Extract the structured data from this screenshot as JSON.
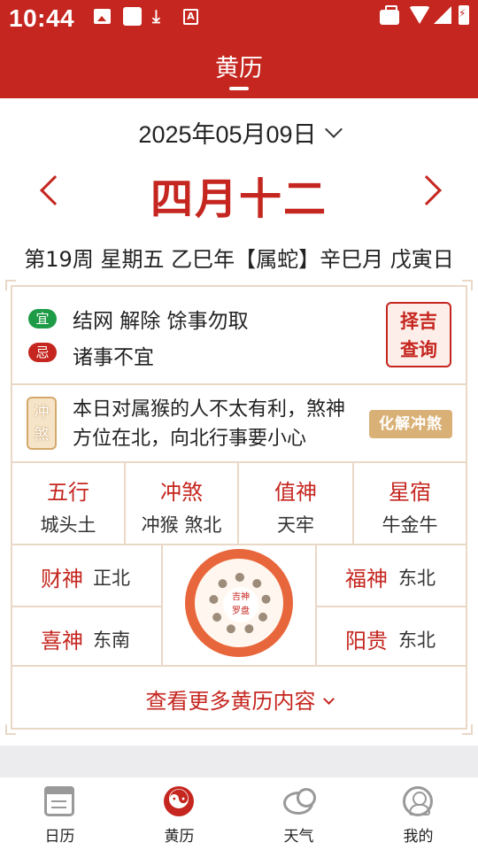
{
  "status_bar": {
    "time": "10:44",
    "a_icon": "A"
  },
  "header": {
    "title": "黄历"
  },
  "date": {
    "solar": "2025年05月09日",
    "lunar": "四月十二",
    "detail": "第19周 星期五 乙巳年【属蛇】辛巳月 戊寅日"
  },
  "yi_ji": {
    "yi_tag": "宜",
    "yi_text": "结网 解除 馀事勿取",
    "ji_tag": "忌",
    "ji_text": "诸事不宜",
    "zeji_line1": "择吉",
    "zeji_line2": "查询"
  },
  "chongsha": {
    "badge_line1": "冲",
    "badge_line2": "煞",
    "text": "本日对属猴的人不太有利，煞神方位在北，向北行事要小心",
    "button": "化解冲煞"
  },
  "attributes": [
    {
      "label": "五行",
      "value": "城头土"
    },
    {
      "label": "冲煞",
      "value": "冲猴 煞北"
    },
    {
      "label": "值神",
      "value": "天牢"
    },
    {
      "label": "星宿",
      "value": "牛金牛"
    }
  ],
  "gods": {
    "caishen": {
      "label": "财神",
      "value": "正北"
    },
    "xishen": {
      "label": "喜神",
      "value": "东南"
    },
    "fushen": {
      "label": "福神",
      "value": "东北"
    },
    "yanggui": {
      "label": "阳贵",
      "value": "东北"
    },
    "luopan": {
      "line1": "吉神",
      "line2": "罗盘"
    }
  },
  "more_link": "查看更多黄历内容",
  "bottom_nav": [
    {
      "label": "日历",
      "icon": "calendar-icon"
    },
    {
      "label": "黄历",
      "icon": "yinyang-icon",
      "active": true
    },
    {
      "label": "天气",
      "icon": "weather-icon"
    },
    {
      "label": "我的",
      "icon": "user-icon"
    }
  ],
  "colors": {
    "primary": "#c5261f",
    "yi_green": "#1e9b46",
    "border": "#ead8c7",
    "gold": "#d9b177"
  }
}
